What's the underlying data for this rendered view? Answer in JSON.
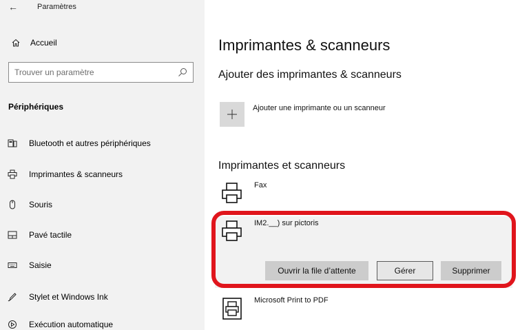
{
  "window": {
    "title": "Paramètres",
    "back_glyph": "←"
  },
  "sidebar": {
    "home_label": "Accueil",
    "search_placeholder": "Trouver un paramètre",
    "section_title": "Périphériques",
    "items": [
      {
        "label": "Bluetooth et autres périphériques",
        "icon": "bluetooth-devices-icon"
      },
      {
        "label": "Imprimantes & scanneurs",
        "icon": "printer-icon"
      },
      {
        "label": "Souris",
        "icon": "mouse-icon"
      },
      {
        "label": "Pavé tactile",
        "icon": "touchpad-icon"
      },
      {
        "label": "Saisie",
        "icon": "keyboard-icon"
      },
      {
        "label": "Stylet et Windows Ink",
        "icon": "pen-icon"
      },
      {
        "label": "Exécution automatique",
        "icon": "autoplay-icon"
      }
    ]
  },
  "main": {
    "page_title": "Imprimantes & scanneurs",
    "add_section_title": "Ajouter des imprimantes & scanneurs",
    "add_label": "Ajouter une imprimante ou un scanneur",
    "list_title": "Imprimantes et scanneurs",
    "printers": [
      {
        "name": "Fax"
      },
      {
        "name": "IM2.__) sur pictoris"
      },
      {
        "name": "Microsoft Print to PDF"
      }
    ],
    "actions": {
      "open_queue": "Ouvrir la file d’attente",
      "manage": "Gérer",
      "remove": "Supprimer"
    }
  },
  "colors": {
    "highlight_outline": "#e0151c",
    "sidebar_bg": "#f2f2f2",
    "button_bg": "#cccccc"
  }
}
